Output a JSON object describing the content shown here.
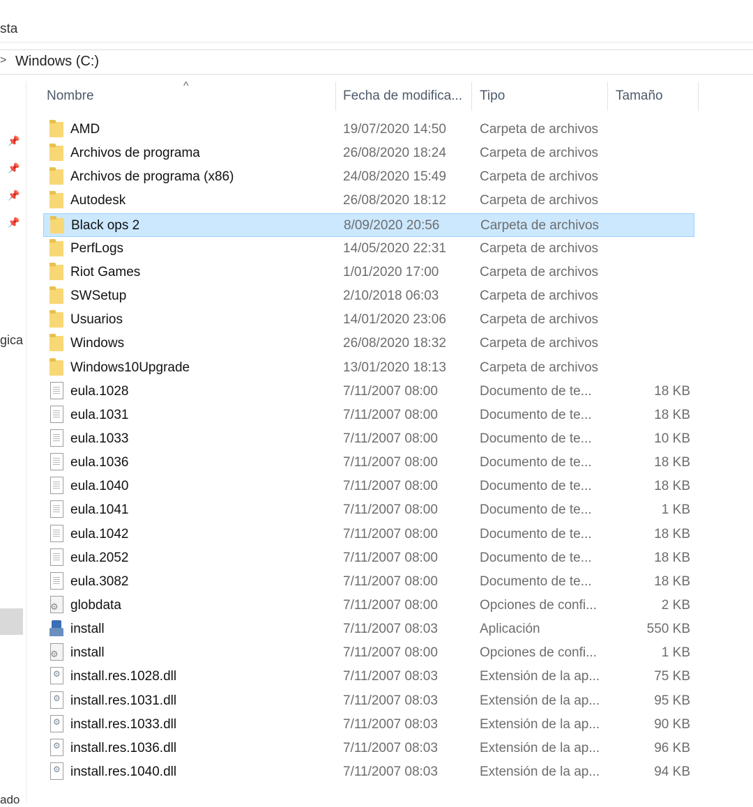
{
  "ribbon": {
    "tab_label": "sta"
  },
  "address": {
    "crumb": "Windows (C:)",
    "separator": ">"
  },
  "sidebar": {
    "fragment_label": "gica",
    "bottom_fragment": "ado"
  },
  "columns": {
    "name": "Nombre",
    "date": "Fecha de modifica...",
    "type": "Tipo",
    "size": "Tamaño",
    "sort_indicator": "^"
  },
  "selected_index": 4,
  "files": [
    {
      "name": "AMD",
      "date": "19/07/2020 14:50",
      "type": "Carpeta de archivos",
      "size": "",
      "icon": "folder-icon"
    },
    {
      "name": "Archivos de programa",
      "date": "26/08/2020 18:24",
      "type": "Carpeta de archivos",
      "size": "",
      "icon": "folder-icon"
    },
    {
      "name": "Archivos de programa (x86)",
      "date": "24/08/2020 15:49",
      "type": "Carpeta de archivos",
      "size": "",
      "icon": "folder-icon"
    },
    {
      "name": "Autodesk",
      "date": "26/08/2020 18:12",
      "type": "Carpeta de archivos",
      "size": "",
      "icon": "folder-icon"
    },
    {
      "name": "Black ops 2",
      "date": "8/09/2020 20:56",
      "type": "Carpeta de archivos",
      "size": "",
      "icon": "folder-icon"
    },
    {
      "name": "PerfLogs",
      "date": "14/05/2020 22:31",
      "type": "Carpeta de archivos",
      "size": "",
      "icon": "folder-icon"
    },
    {
      "name": "Riot Games",
      "date": "1/01/2020 17:00",
      "type": "Carpeta de archivos",
      "size": "",
      "icon": "folder-icon"
    },
    {
      "name": "SWSetup",
      "date": "2/10/2018 06:03",
      "type": "Carpeta de archivos",
      "size": "",
      "icon": "folder-icon"
    },
    {
      "name": "Usuarios",
      "date": "14/01/2020 23:06",
      "type": "Carpeta de archivos",
      "size": "",
      "icon": "folder-icon"
    },
    {
      "name": "Windows",
      "date": "26/08/2020 18:32",
      "type": "Carpeta de archivos",
      "size": "",
      "icon": "folder-icon"
    },
    {
      "name": "Windows10Upgrade",
      "date": "13/01/2020 18:13",
      "type": "Carpeta de archivos",
      "size": "",
      "icon": "folder-icon"
    },
    {
      "name": "eula.1028",
      "date": "7/11/2007 08:00",
      "type": "Documento de te...",
      "size": "18 KB",
      "icon": "text-document-icon"
    },
    {
      "name": "eula.1031",
      "date": "7/11/2007 08:00",
      "type": "Documento de te...",
      "size": "18 KB",
      "icon": "text-document-icon"
    },
    {
      "name": "eula.1033",
      "date": "7/11/2007 08:00",
      "type": "Documento de te...",
      "size": "10 KB",
      "icon": "text-document-icon"
    },
    {
      "name": "eula.1036",
      "date": "7/11/2007 08:00",
      "type": "Documento de te...",
      "size": "18 KB",
      "icon": "text-document-icon"
    },
    {
      "name": "eula.1040",
      "date": "7/11/2007 08:00",
      "type": "Documento de te...",
      "size": "18 KB",
      "icon": "text-document-icon"
    },
    {
      "name": "eula.1041",
      "date": "7/11/2007 08:00",
      "type": "Documento de te...",
      "size": "1 KB",
      "icon": "text-document-icon"
    },
    {
      "name": "eula.1042",
      "date": "7/11/2007 08:00",
      "type": "Documento de te...",
      "size": "18 KB",
      "icon": "text-document-icon"
    },
    {
      "name": "eula.2052",
      "date": "7/11/2007 08:00",
      "type": "Documento de te...",
      "size": "18 KB",
      "icon": "text-document-icon"
    },
    {
      "name": "eula.3082",
      "date": "7/11/2007 08:00",
      "type": "Documento de te...",
      "size": "18 KB",
      "icon": "text-document-icon"
    },
    {
      "name": "globdata",
      "date": "7/11/2007 08:00",
      "type": "Opciones de confi...",
      "size": "2 KB",
      "icon": "config-file-icon"
    },
    {
      "name": "install",
      "date": "7/11/2007 08:03",
      "type": "Aplicación",
      "size": "550 KB",
      "icon": "application-icon"
    },
    {
      "name": "install",
      "date": "7/11/2007 08:00",
      "type": "Opciones de confi...",
      "size": "1 KB",
      "icon": "config-file-icon"
    },
    {
      "name": "install.res.1028.dll",
      "date": "7/11/2007 08:03",
      "type": "Extensión de la ap...",
      "size": "75 KB",
      "icon": "dll-file-icon"
    },
    {
      "name": "install.res.1031.dll",
      "date": "7/11/2007 08:03",
      "type": "Extensión de la ap...",
      "size": "95 KB",
      "icon": "dll-file-icon"
    },
    {
      "name": "install.res.1033.dll",
      "date": "7/11/2007 08:03",
      "type": "Extensión de la ap...",
      "size": "90 KB",
      "icon": "dll-file-icon"
    },
    {
      "name": "install.res.1036.dll",
      "date": "7/11/2007 08:03",
      "type": "Extensión de la ap...",
      "size": "96 KB",
      "icon": "dll-file-icon"
    },
    {
      "name": "install.res.1040.dll",
      "date": "7/11/2007 08:03",
      "type": "Extensión de la ap...",
      "size": "94 KB",
      "icon": "dll-file-icon"
    }
  ],
  "colors": {
    "selection_fill": "#cce8ff",
    "selection_border": "#99d1ff",
    "folder": "#f8d775",
    "header_text": "#4d5a6a"
  }
}
